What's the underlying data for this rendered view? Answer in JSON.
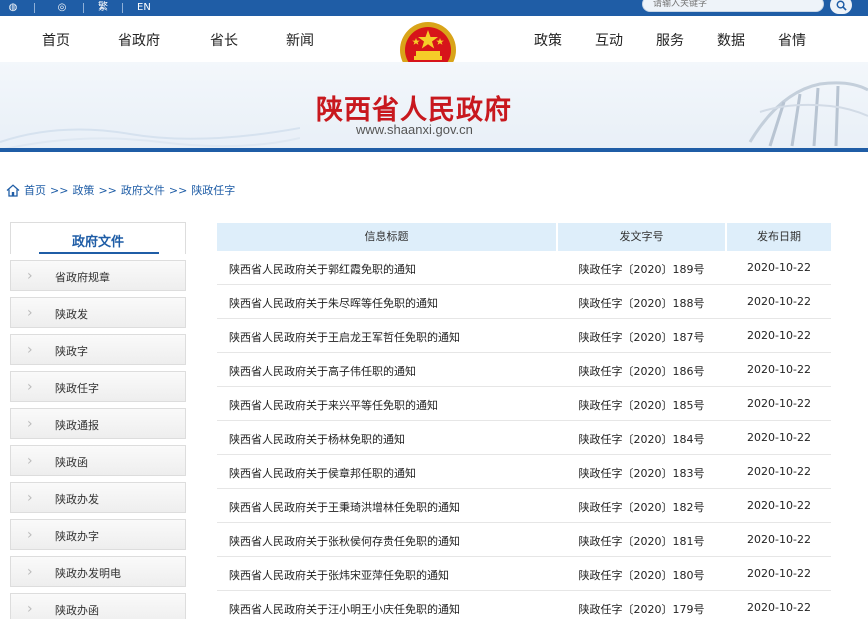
{
  "topbar": {
    "icon_weibo": "weibo-icon",
    "icon_wechat": "wechat-icon",
    "link_1": "繁",
    "link_2": "EN",
    "search_placeholder": "请输入关键字",
    "search_icon": "search-icon"
  },
  "nav": {
    "left": [
      "首页",
      "省政府",
      "省长",
      "新闻"
    ],
    "right": [
      "政策",
      "互动",
      "服务",
      "数据",
      "省情"
    ],
    "emblem": "national-emblem-icon"
  },
  "banner": {
    "title": "陕西省人民政府",
    "url": "www.shaanxi.gov.cn"
  },
  "breadcrumb": {
    "home_icon": "home-icon",
    "items": [
      "首页",
      "政策",
      "政府文件",
      "陕政任字"
    ],
    "separator": ">>"
  },
  "sidebar": {
    "title": "政府文件",
    "items": [
      "省政府规章",
      "陕政发",
      "陕政字",
      "陕政任字",
      "陕政通报",
      "陕政函",
      "陕政办发",
      "陕政办字",
      "陕政办发明电",
      "陕政办函"
    ]
  },
  "table": {
    "headers": [
      "信息标题",
      "发文字号",
      "发布日期"
    ],
    "rows": [
      {
        "title": "陕西省人民政府关于郭红霞免职的通知",
        "number": "陕政任字〔2020〕189号",
        "date": "2020-10-22"
      },
      {
        "title": "陕西省人民政府关于朱尽晖等任免职的通知",
        "number": "陕政任字〔2020〕188号",
        "date": "2020-10-22"
      },
      {
        "title": "陕西省人民政府关于王启龙王军哲任免职的通知",
        "number": "陕政任字〔2020〕187号",
        "date": "2020-10-22"
      },
      {
        "title": "陕西省人民政府关于高子伟任职的通知",
        "number": "陕政任字〔2020〕186号",
        "date": "2020-10-22"
      },
      {
        "title": "陕西省人民政府关于来兴平等任免职的通知",
        "number": "陕政任字〔2020〕185号",
        "date": "2020-10-22"
      },
      {
        "title": "陕西省人民政府关于杨林免职的通知",
        "number": "陕政任字〔2020〕184号",
        "date": "2020-10-22"
      },
      {
        "title": "陕西省人民政府关于侯章邦任职的通知",
        "number": "陕政任字〔2020〕183号",
        "date": "2020-10-22"
      },
      {
        "title": "陕西省人民政府关于王秉琦洪增林任免职的通知",
        "number": "陕政任字〔2020〕182号",
        "date": "2020-10-22"
      },
      {
        "title": "陕西省人民政府关于张秋侯何存贵任免职的通知",
        "number": "陕政任字〔2020〕181号",
        "date": "2020-10-22"
      },
      {
        "title": "陕西省人民政府关于张炜宋亚萍任免职的通知",
        "number": "陕政任字〔2020〕180号",
        "date": "2020-10-22"
      },
      {
        "title": "陕西省人民政府关于汪小明王小庆任免职的通知",
        "number": "陕政任字〔2020〕179号",
        "date": "2020-10-22"
      }
    ]
  },
  "colors": {
    "primary": "#1f5da6",
    "title_red": "#c8181e",
    "header_bg": "#deeefa"
  }
}
